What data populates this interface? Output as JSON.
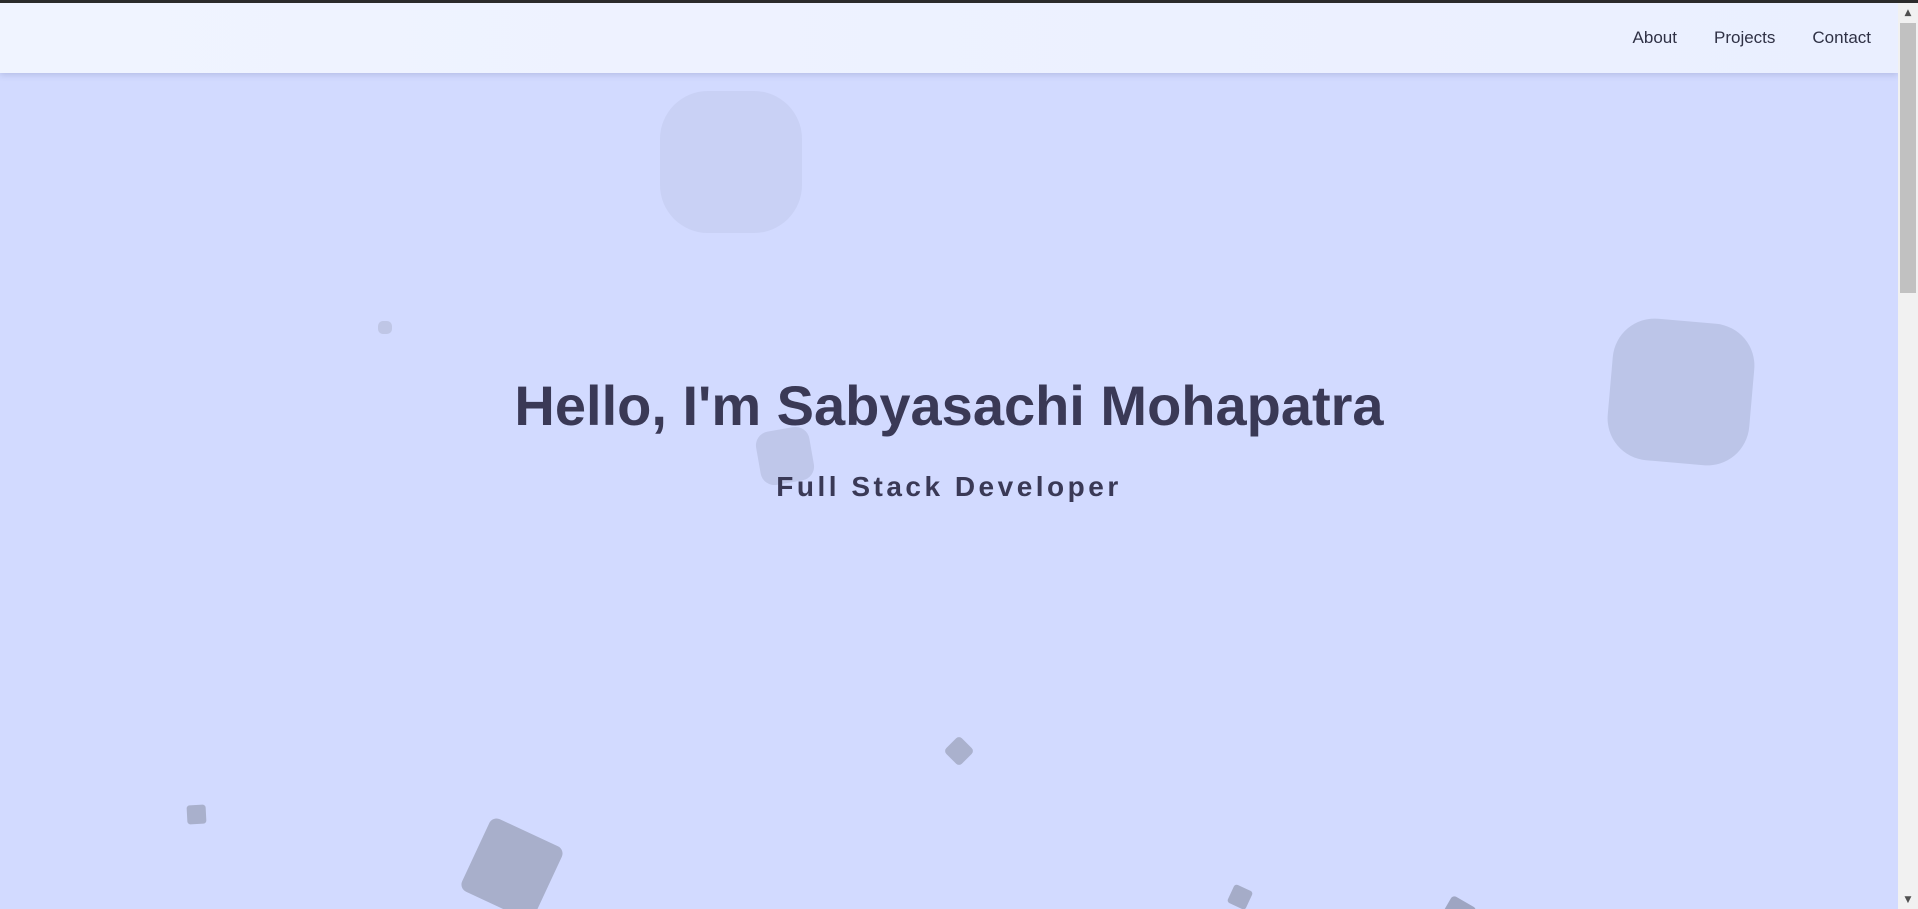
{
  "nav": {
    "links": [
      "About",
      "Projects",
      "Contact"
    ]
  },
  "hero": {
    "title": "Hello, I'm Sabyasachi Mohapatra",
    "subtitle": "Full Stack Developer"
  },
  "colors": {
    "background": "#d2daff",
    "navbar": "#eef2ff",
    "text": "#3a3956",
    "shape_light": "#c8d0f2",
    "shape_mid": "#bcc4e6",
    "shape_dark": "#a9b0cc"
  },
  "scrollbar": {
    "up_icon": "triangle-up-icon",
    "down_icon": "triangle-down-icon"
  }
}
